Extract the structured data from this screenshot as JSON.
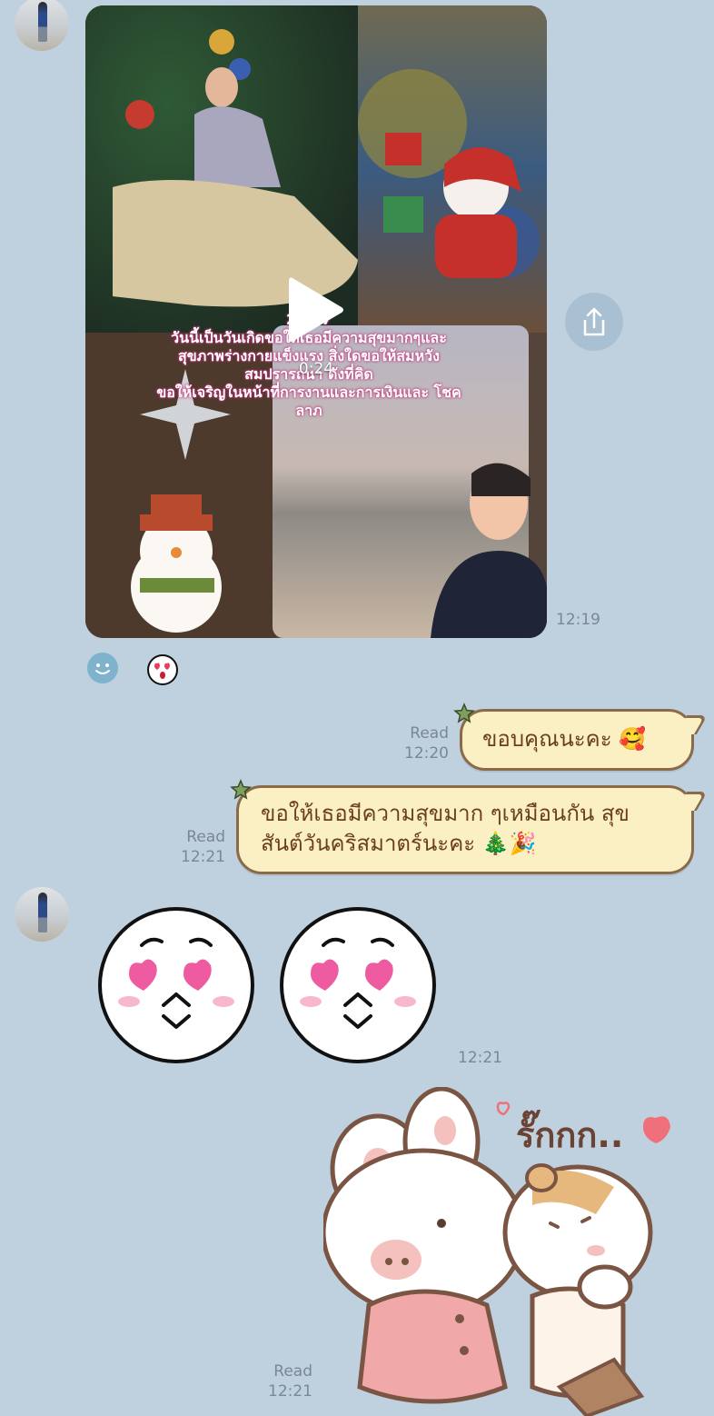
{
  "messages": {
    "video": {
      "duration": "0:24",
      "caption_lines": [
        "25 67",
        "วันนี้เป็นวันเกิดขอให้เธอมีความสุขมากๆและ",
        "สุขภาพร่างกายแข็งแรง สิ่งใดขอให้สมหวัง",
        "สมปรารถนา ดังที่คิด",
        "ขอให้เจริญในหน้าที่การงานและการเงินและ โชค",
        "ลาภ"
      ],
      "time": "12:19"
    },
    "reply_1": {
      "read_label": "Read",
      "time": "12:20",
      "text": "ขอบคุณนะคะ 🥰"
    },
    "reply_2": {
      "read_label": "Read",
      "time": "12:21",
      "line1": "ขอให้เธอมีความสุขมาก ๆเหมือนกัน สุข",
      "line2": "สันต์วันคริสมาตร์นะคะ 🎄🎉"
    },
    "sticker_heart_eyes": {
      "time": "12:21"
    },
    "sticker_bunny": {
      "text": "รั๊กกก..",
      "read_label": "Read",
      "time": "12:21"
    }
  },
  "icons": {
    "share": "share-icon",
    "play": "play-icon",
    "reaction_1": "smiley-reaction-icon",
    "reaction_2": "heart-eyes-reaction-icon"
  },
  "colors": {
    "background": "#bfd1df",
    "bubble_fill": "#fbf0c3",
    "bubble_border": "#8b6a4a",
    "bubble_text": "#6b3f1e",
    "meta_text": "#7b8793"
  }
}
